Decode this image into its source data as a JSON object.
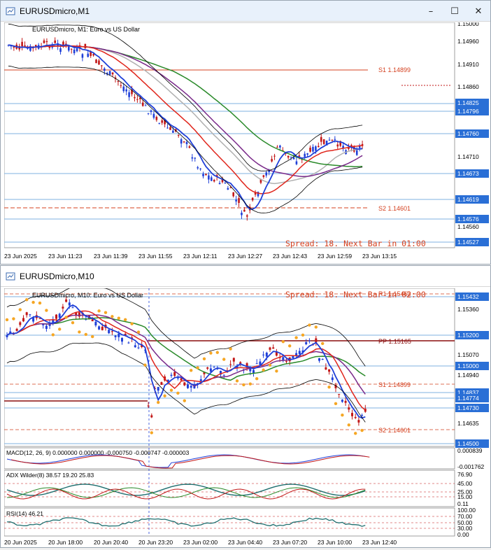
{
  "colors": {
    "grid": "#7fb2e0",
    "candle_up": "#1f3fd8",
    "candle_down": "#c21717",
    "pivot": "#d4401f",
    "ma_blue": "#1f3fd8",
    "ma_red": "#e0251b",
    "ma_purple": "#7a2a8a",
    "ma_green": "#2a8a2a",
    "ma_gray": "#b0b0b0",
    "bb": "#000000",
    "psar": "#f5a623",
    "highlight": "#2a6fd6"
  },
  "top_window": {
    "title": "EURUSDmicro,M1",
    "controls": {
      "minimize": "–",
      "maximize": "☐",
      "close": "✕"
    },
    "chart_label": "EURUSDmicro, M1:  Euro vs US Dollar",
    "spread_text": "Spread: 18. Next Bar in 01:00",
    "s1_label": "S1 1.14899",
    "s2_label": "S2 1.14601",
    "price_axis": [
      "1.15000",
      "1.14960",
      "1.14910",
      "1.14860",
      "1.14825",
      "1.14796",
      "1.14760",
      "1.14710",
      "1.14673",
      "1.14619",
      "1.14576",
      "1.14560",
      "1.14527"
    ],
    "time_axis": [
      "23 Jun 2025",
      "23 Jun 11:23",
      "23 Jun 11:39",
      "23 Jun 11:55",
      "23 Jun 12:11",
      "23 Jun 12:27",
      "23 Jun 12:43",
      "23 Jun 12:59",
      "23 Jun 13:15"
    ]
  },
  "bottom_window": {
    "title": "EURUSDmicro,M10",
    "controls": {
      "minimize": "–",
      "maximize": "☐",
      "close": "✕"
    },
    "chart_label": "EURUSDmicro, M10:  Euro vs US Dollar",
    "spread_text": "Spread: 18. Next Bar in 02:00",
    "r1_label": "R1 1.15463",
    "pp_label": "PP 1.15165",
    "s1_label": "S1 1.14899",
    "s2_label": "S2 1.14601",
    "price_axis": [
      "1.15432",
      "1.15360",
      "1.15200",
      "1.15070",
      "1.15000",
      "1.14940",
      "1.14837",
      "1.14774",
      "1.14730",
      "1.14635",
      "1.14500"
    ],
    "macd_label": "MACD(12, 26, 9) 0.000000 0.000000 -0.000750 -0.000747 -0.000003",
    "macd_axis": [
      "0.000839",
      "-0.001762"
    ],
    "adx_label": "ADX Wilder(8) 38.57 19.20 25.83",
    "adx_axis": [
      "76.90",
      "45.00",
      "25.00",
      "15.00",
      "0.11"
    ],
    "rsi_label": "RSI(14) 46.21",
    "rsi_axis": [
      "100.00",
      "70.00",
      "50.00",
      "30.00",
      "0.00"
    ],
    "time_axis": [
      "20 Jun 2025",
      "20 Jun 18:00",
      "20 Jun 20:40",
      "20 Jun 23:20",
      "23 Jun 02:00",
      "23 Jun 04:40",
      "23 Jun 07:20",
      "23 Jun 10:00",
      "23 Jun 12:40"
    ]
  }
}
